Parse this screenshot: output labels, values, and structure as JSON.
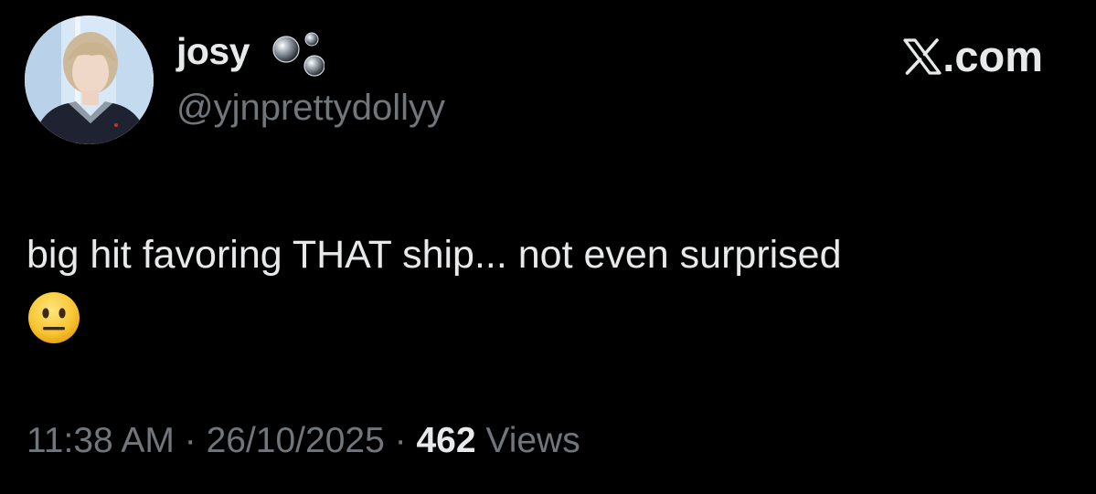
{
  "post": {
    "author": {
      "display_name": "josy",
      "name_icon": "bubbles-icon",
      "handle": "@yjnprettydollyy",
      "avatar_icon": "avatar"
    },
    "brand": {
      "logo_icon": "x-logo-icon",
      "label": ".com"
    },
    "text": "big hit favoring THAT ship... not even surprised",
    "emoji": "neutral-face-emoji",
    "meta": {
      "time": "11:38 AM",
      "separator": "·",
      "date": "26/10/2025",
      "views_count": "462",
      "views_label": "Views"
    }
  },
  "colors": {
    "background": "#000000",
    "primary_text": "#e7e9ea",
    "secondary_text": "#71767b"
  }
}
